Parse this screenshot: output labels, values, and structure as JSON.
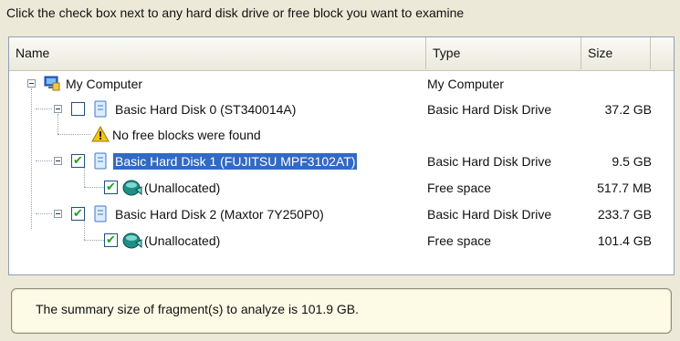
{
  "instruction": "Click the check box next to any hard disk drive or free block you want to examine",
  "columns": {
    "name": "Name",
    "type": "Type",
    "size": "Size"
  },
  "tree": {
    "root": {
      "label": "My Computer",
      "type": "My Computer"
    },
    "disk0": {
      "label": "Basic Hard Disk 0 (ST340014A)",
      "type": "Basic Hard Disk Drive",
      "size": "37.2 GB",
      "checked": false
    },
    "disk0_note": {
      "label": "No free blocks were found"
    },
    "disk1": {
      "label": "Basic Hard Disk 1 (FUJITSU MPF3102AT)",
      "type": "Basic Hard Disk Drive",
      "size": "9.5 GB",
      "checked": true
    },
    "disk1_unalloc": {
      "label": "(Unallocated)",
      "type": "Free space",
      "size": "517.7 MB",
      "checked": true
    },
    "disk2": {
      "label": "Basic Hard Disk 2 (Maxtor 7Y250P0)",
      "type": "Basic Hard Disk Drive",
      "size": "233.7 GB",
      "checked": true
    },
    "disk2_unalloc": {
      "label": "(Unallocated)",
      "type": "Free space",
      "size": "101.4 GB",
      "checked": true
    }
  },
  "summary": "The summary size of fragment(s) to analyze is 101.9 GB.",
  "check_mark": "✔",
  "colors": {
    "selection": "#316ac5",
    "check": "#21a121",
    "panel_border": "#8f9fb8"
  }
}
